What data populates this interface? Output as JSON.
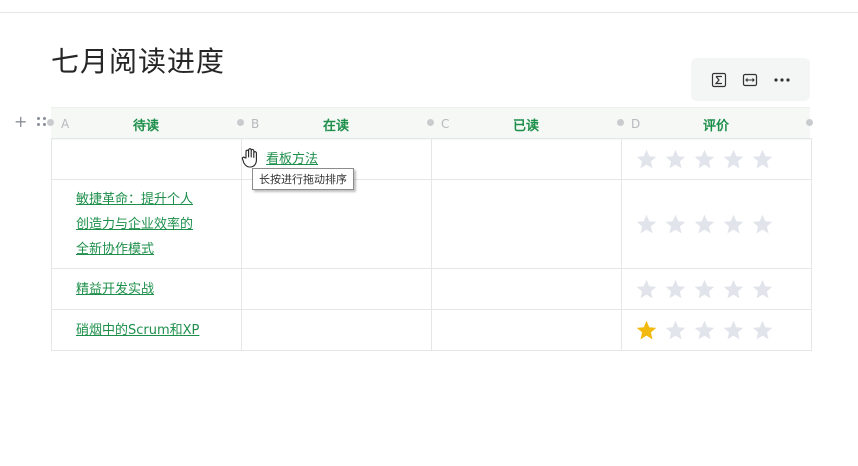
{
  "page": {
    "title": "七月阅读进度"
  },
  "toolbar": {
    "buttons": [
      {
        "name": "formula-icon"
      },
      {
        "name": "column-width-icon"
      },
      {
        "name": "more-icon"
      }
    ]
  },
  "table": {
    "columns": [
      {
        "letter": "A",
        "title": "待读"
      },
      {
        "letter": "B",
        "title": "在读"
      },
      {
        "letter": "C",
        "title": "已读"
      },
      {
        "letter": "D",
        "title": "评价"
      }
    ],
    "rows": [
      {
        "a": "",
        "b": "看板方法",
        "c": "",
        "rating": 0
      },
      {
        "a_lines": [
          "敏捷革命：提升个人",
          "创造力与企业效率的",
          "全新协作模式"
        ],
        "b": "",
        "c": "",
        "rating": 0
      },
      {
        "a": "精益开发实战",
        "b": "",
        "c": "",
        "rating": 0
      },
      {
        "a": "硝烟中的Scrum和XP",
        "b": "",
        "c": "",
        "rating": 1
      }
    ]
  },
  "tooltip": {
    "text": "长按进行拖动排序"
  },
  "colors": {
    "accent": "#1e8f4b",
    "star_filled": "#f2b90f",
    "star_empty": "#e2e4ec"
  }
}
